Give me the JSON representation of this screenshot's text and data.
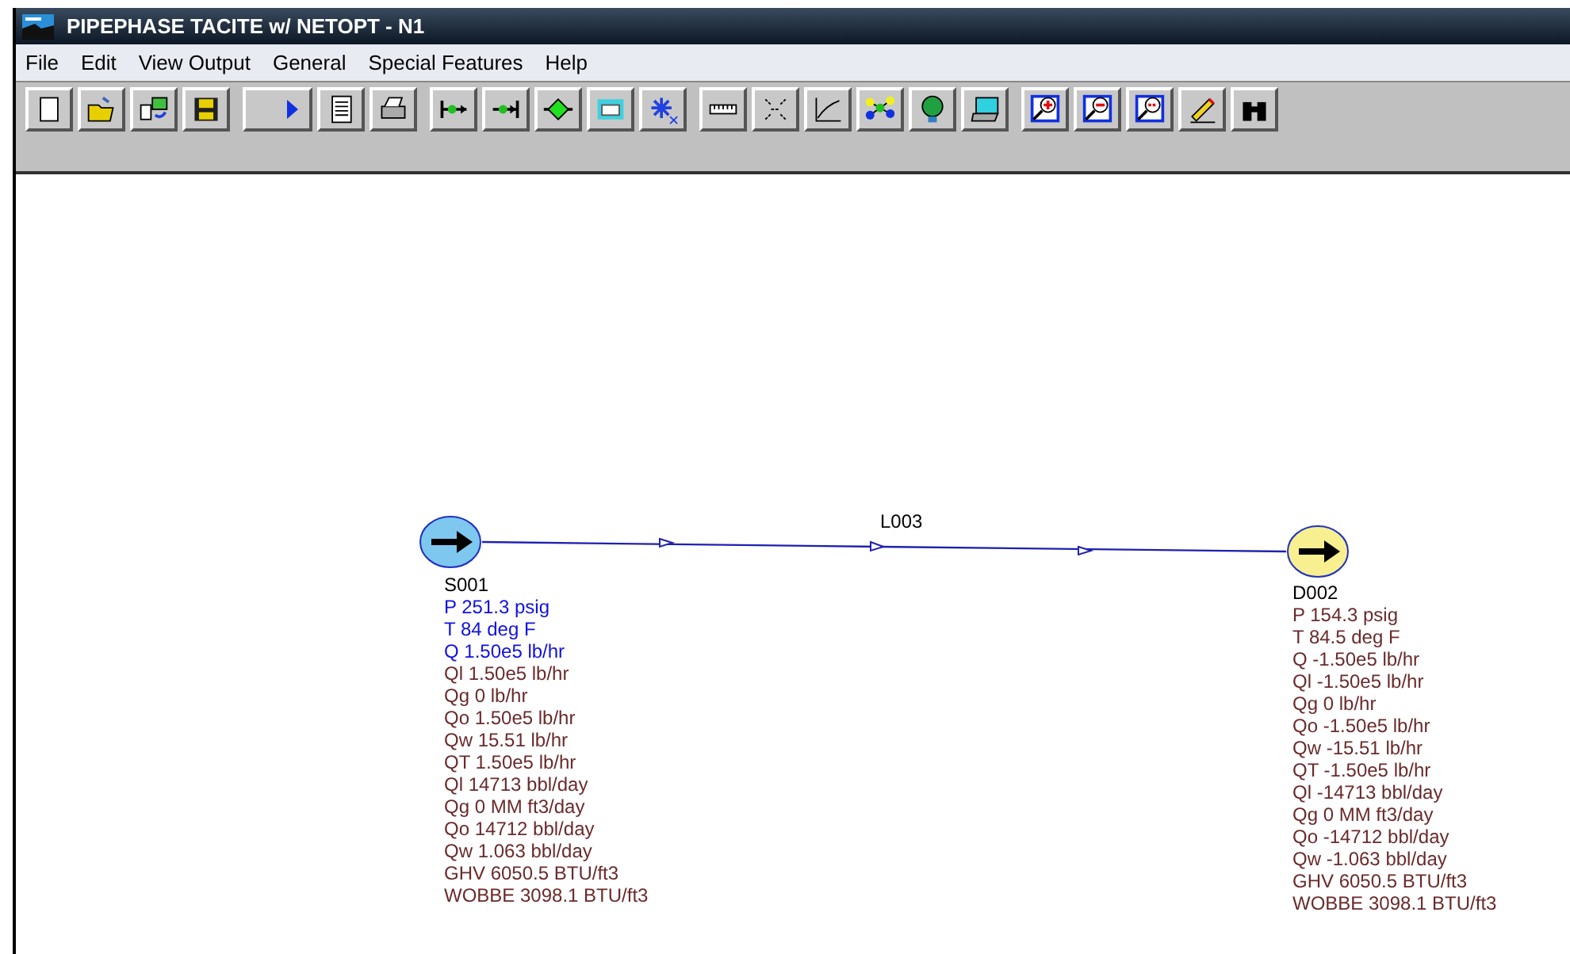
{
  "window": {
    "title": "PIPEPHASE TACITE w/ NETOPT - N1"
  },
  "menu": [
    "File",
    "Edit",
    "View Output",
    "General",
    "Special Features",
    "Help"
  ],
  "link": {
    "label": "L003"
  },
  "source": {
    "name": "S001",
    "lines": [
      {
        "text": "P 251.3 psig",
        "highlighted": true
      },
      {
        "text": "T 84 deg F",
        "highlighted": true
      },
      {
        "text": "Q 1.50e5 lb/hr",
        "highlighted": true
      },
      {
        "text": "Ql 1.50e5 lb/hr",
        "highlighted": false
      },
      {
        "text": "Qg 0 lb/hr",
        "highlighted": false
      },
      {
        "text": "Qo 1.50e5 lb/hr",
        "highlighted": false
      },
      {
        "text": "Qw 15.51 lb/hr",
        "highlighted": false
      },
      {
        "text": "QT 1.50e5 lb/hr",
        "highlighted": false
      },
      {
        "text": "Ql 14713 bbl/day",
        "highlighted": false
      },
      {
        "text": "Qg 0 MM ft3/day",
        "highlighted": false
      },
      {
        "text": "Qo 14712 bbl/day",
        "highlighted": false
      },
      {
        "text": "Qw 1.063 bbl/day",
        "highlighted": false
      },
      {
        "text": "GHV 6050.5 BTU/ft3",
        "highlighted": false
      },
      {
        "text": "WOBBE 3098.1 BTU/ft3",
        "highlighted": false
      }
    ]
  },
  "sink": {
    "name": "D002",
    "lines": [
      {
        "text": "P 154.3 psig",
        "highlighted": false
      },
      {
        "text": "T 84.5 deg F",
        "highlighted": false
      },
      {
        "text": "Q -1.50e5 lb/hr",
        "highlighted": false
      },
      {
        "text": "Ql -1.50e5 lb/hr",
        "highlighted": false
      },
      {
        "text": "Qg 0 lb/hr",
        "highlighted": false
      },
      {
        "text": "Qo -1.50e5 lb/hr",
        "highlighted": false
      },
      {
        "text": "Qw -15.51 lb/hr",
        "highlighted": false
      },
      {
        "text": "QT -1.50e5 lb/hr",
        "highlighted": false
      },
      {
        "text": "Ql -14713 bbl/day",
        "highlighted": false
      },
      {
        "text": "Qg 0 MM ft3/day",
        "highlighted": false
      },
      {
        "text": "Qo -14712 bbl/day",
        "highlighted": false
      },
      {
        "text": "Qw -1.063 bbl/day",
        "highlighted": false
      },
      {
        "text": "GHV 6050.5 BTU/ft3",
        "highlighted": false
      },
      {
        "text": "WOBBE 3098.1 BTU/ft3",
        "highlighted": false
      }
    ]
  }
}
